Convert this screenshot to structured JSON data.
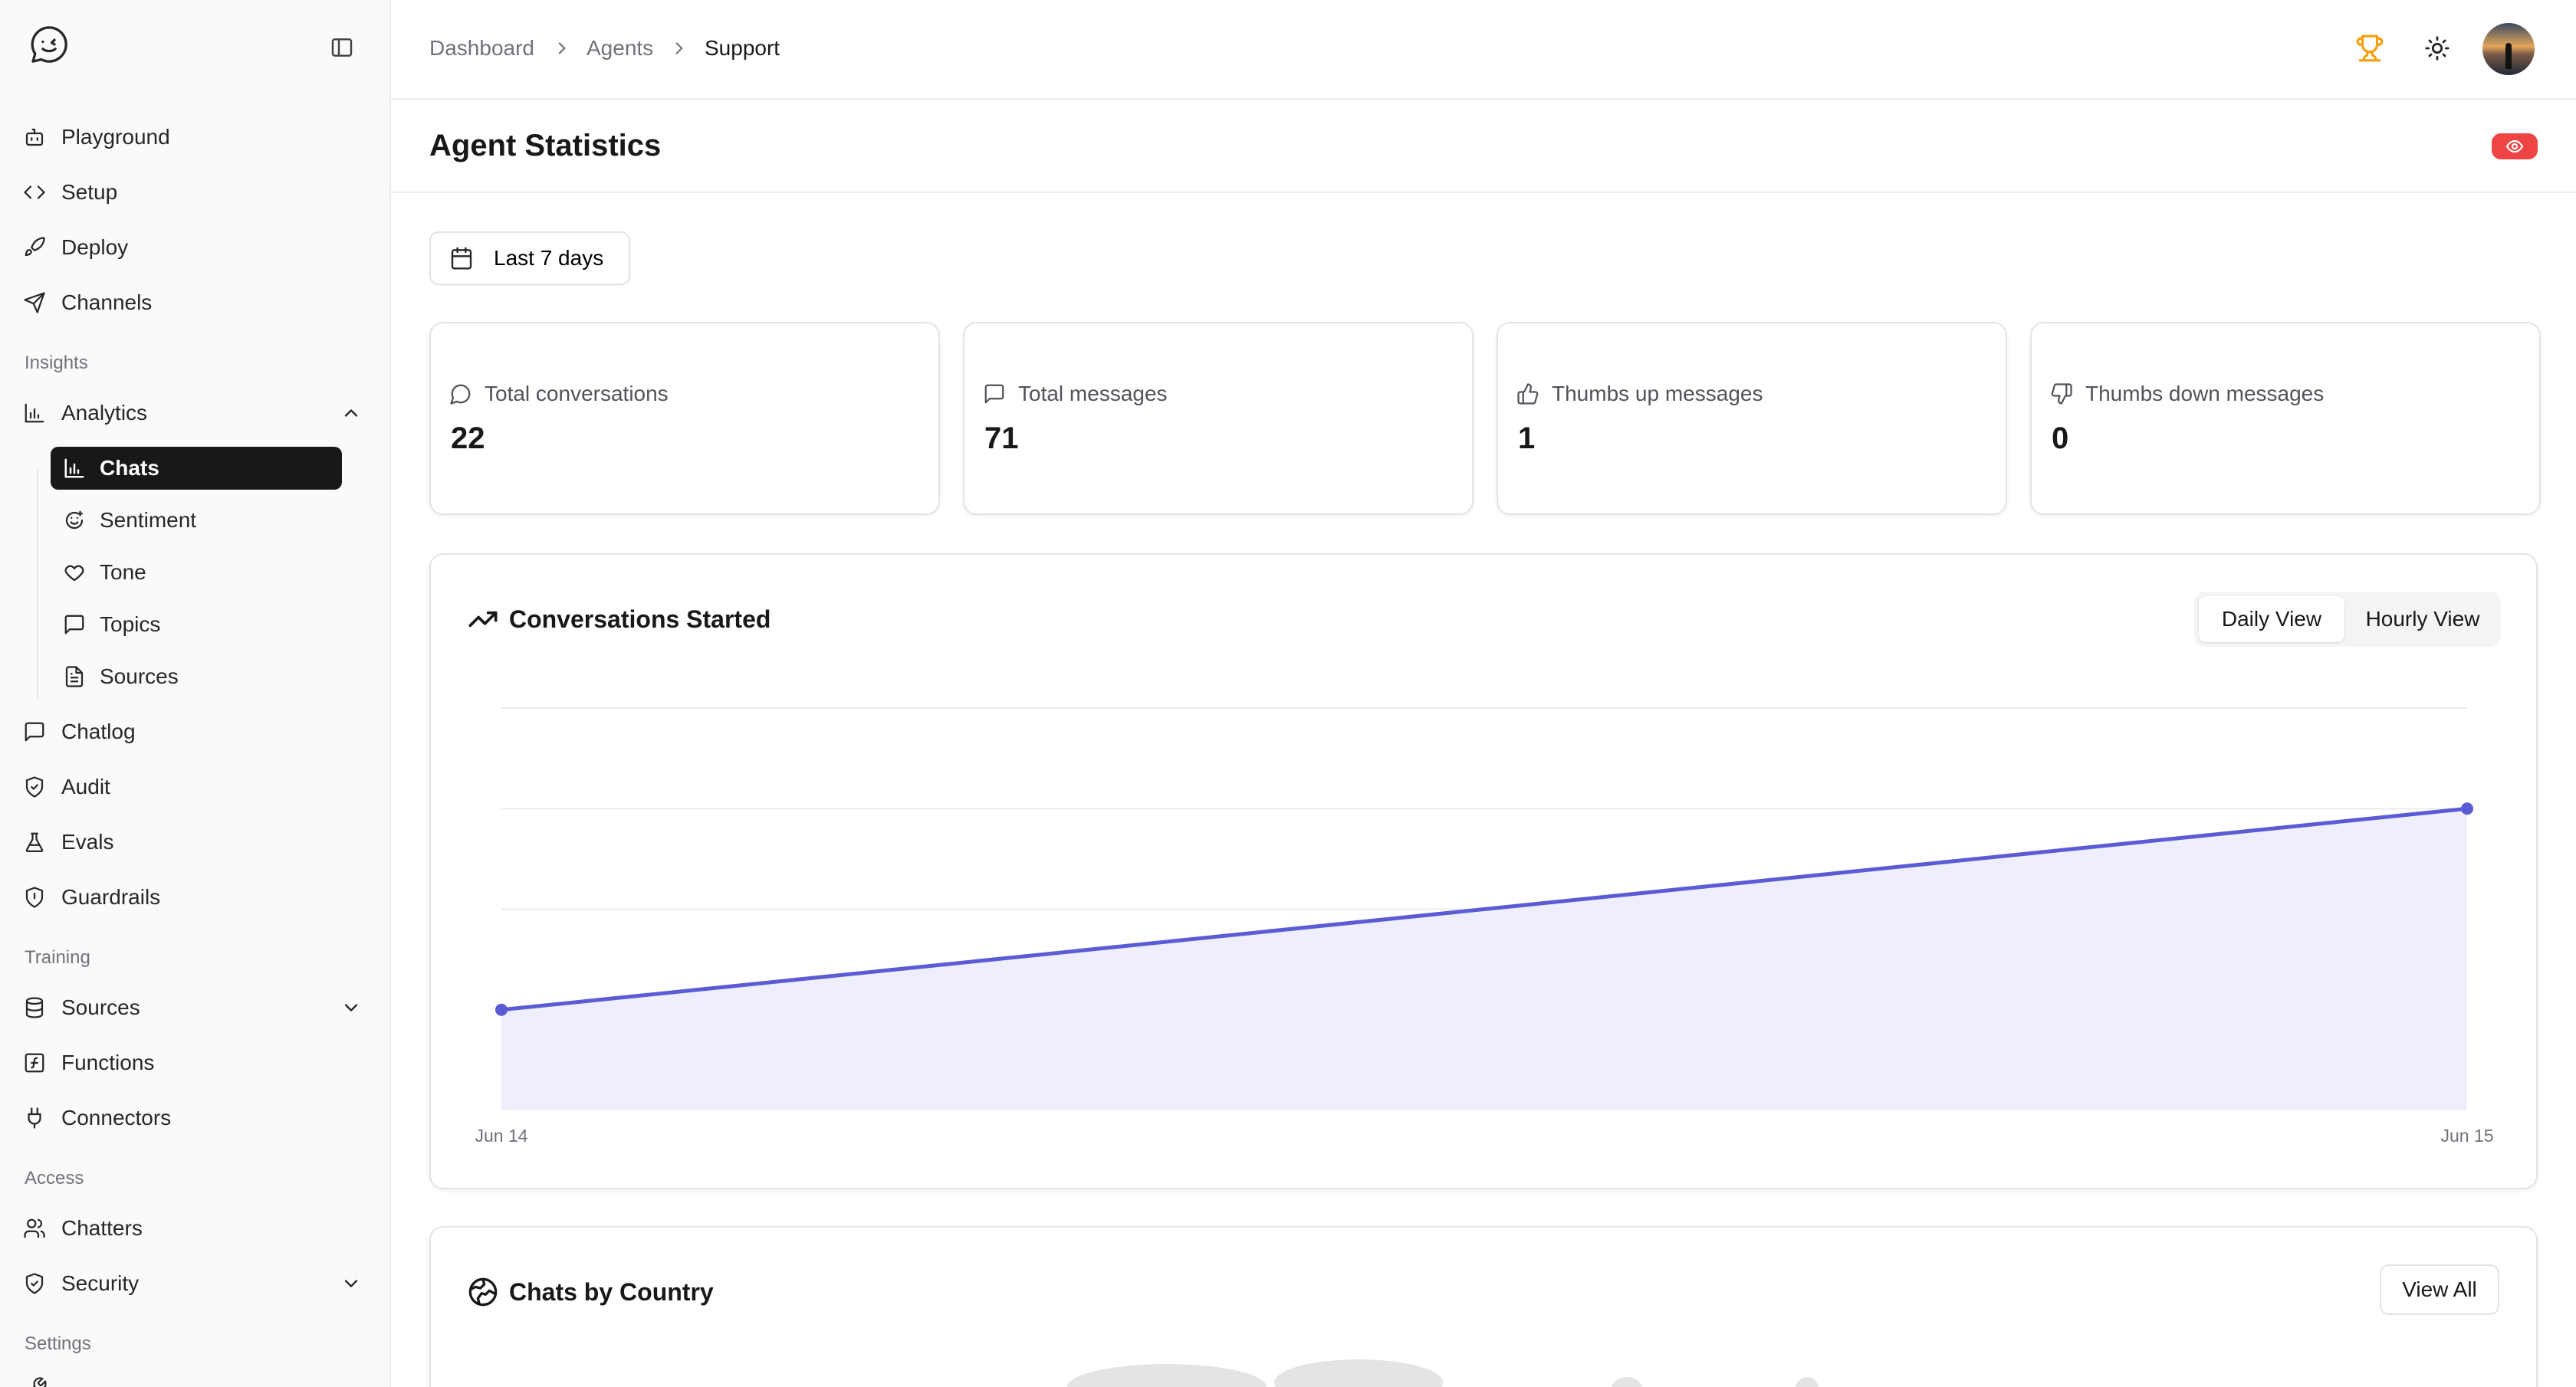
{
  "sidebar": {
    "items_top": [
      {
        "label": "Playground",
        "icon": "bot-icon"
      },
      {
        "label": "Setup",
        "icon": "code-icon"
      },
      {
        "label": "Deploy",
        "icon": "rocket-icon"
      },
      {
        "label": "Channels",
        "icon": "send-icon"
      }
    ],
    "insights_label": "Insights",
    "analytics_label": "Analytics",
    "analytics_sub": [
      {
        "label": "Chats",
        "icon": "bar-chart-icon",
        "active": true
      },
      {
        "label": "Sentiment",
        "icon": "smile-icon"
      },
      {
        "label": "Tone",
        "icon": "heart-icon"
      },
      {
        "label": "Topics",
        "icon": "message-square-icon"
      },
      {
        "label": "Sources",
        "icon": "file-text-icon"
      }
    ],
    "items_mid": [
      {
        "label": "Chatlog",
        "icon": "message-square-icon"
      },
      {
        "label": "Audit",
        "icon": "shield-check-icon"
      },
      {
        "label": "Evals",
        "icon": "flask-icon"
      },
      {
        "label": "Guardrails",
        "icon": "shield-icon"
      }
    ],
    "training_label": "Training",
    "items_training": [
      {
        "label": "Sources",
        "icon": "database-icon"
      },
      {
        "label": "Functions",
        "icon": "function-icon"
      },
      {
        "label": "Connectors",
        "icon": "plug-icon"
      }
    ],
    "access_label": "Access",
    "items_access": [
      {
        "label": "Chatters",
        "icon": "users-icon"
      },
      {
        "label": "Security",
        "icon": "shield-check-icon"
      }
    ],
    "settings_label": "Settings"
  },
  "breadcrumb": [
    "Dashboard",
    "Agents",
    "Support"
  ],
  "page": {
    "title": "Agent Statistics"
  },
  "date_range": "Last 7 days",
  "stats": [
    {
      "label": "Total conversations",
      "value": "22",
      "icon": "message-circle-icon"
    },
    {
      "label": "Total messages",
      "value": "71",
      "icon": "message-square-icon"
    },
    {
      "label": "Thumbs up messages",
      "value": "1",
      "icon": "thumbs-up-icon"
    },
    {
      "label": "Thumbs down messages",
      "value": "0",
      "icon": "thumbs-down-icon"
    }
  ],
  "conversations_card": {
    "title": "Conversations Started",
    "toggle": {
      "daily": "Daily View",
      "hourly": "Hourly View",
      "selected": "Daily View"
    }
  },
  "chart_data": {
    "type": "area",
    "x": [
      "Jun 14",
      "Jun 15"
    ],
    "series": [
      {
        "values": [
          1,
          3
        ]
      }
    ],
    "ylim": [
      0,
      4
    ],
    "grid": true,
    "color": "#5b5bd6",
    "fill": "#eeeefc"
  },
  "country_card": {
    "title": "Chats by Country",
    "view_all": "View All"
  },
  "colors": {
    "accent": "#5b5bd6",
    "active_nav": "#18181b",
    "badge": "#ef4444",
    "trophy": "#f59e0b"
  }
}
